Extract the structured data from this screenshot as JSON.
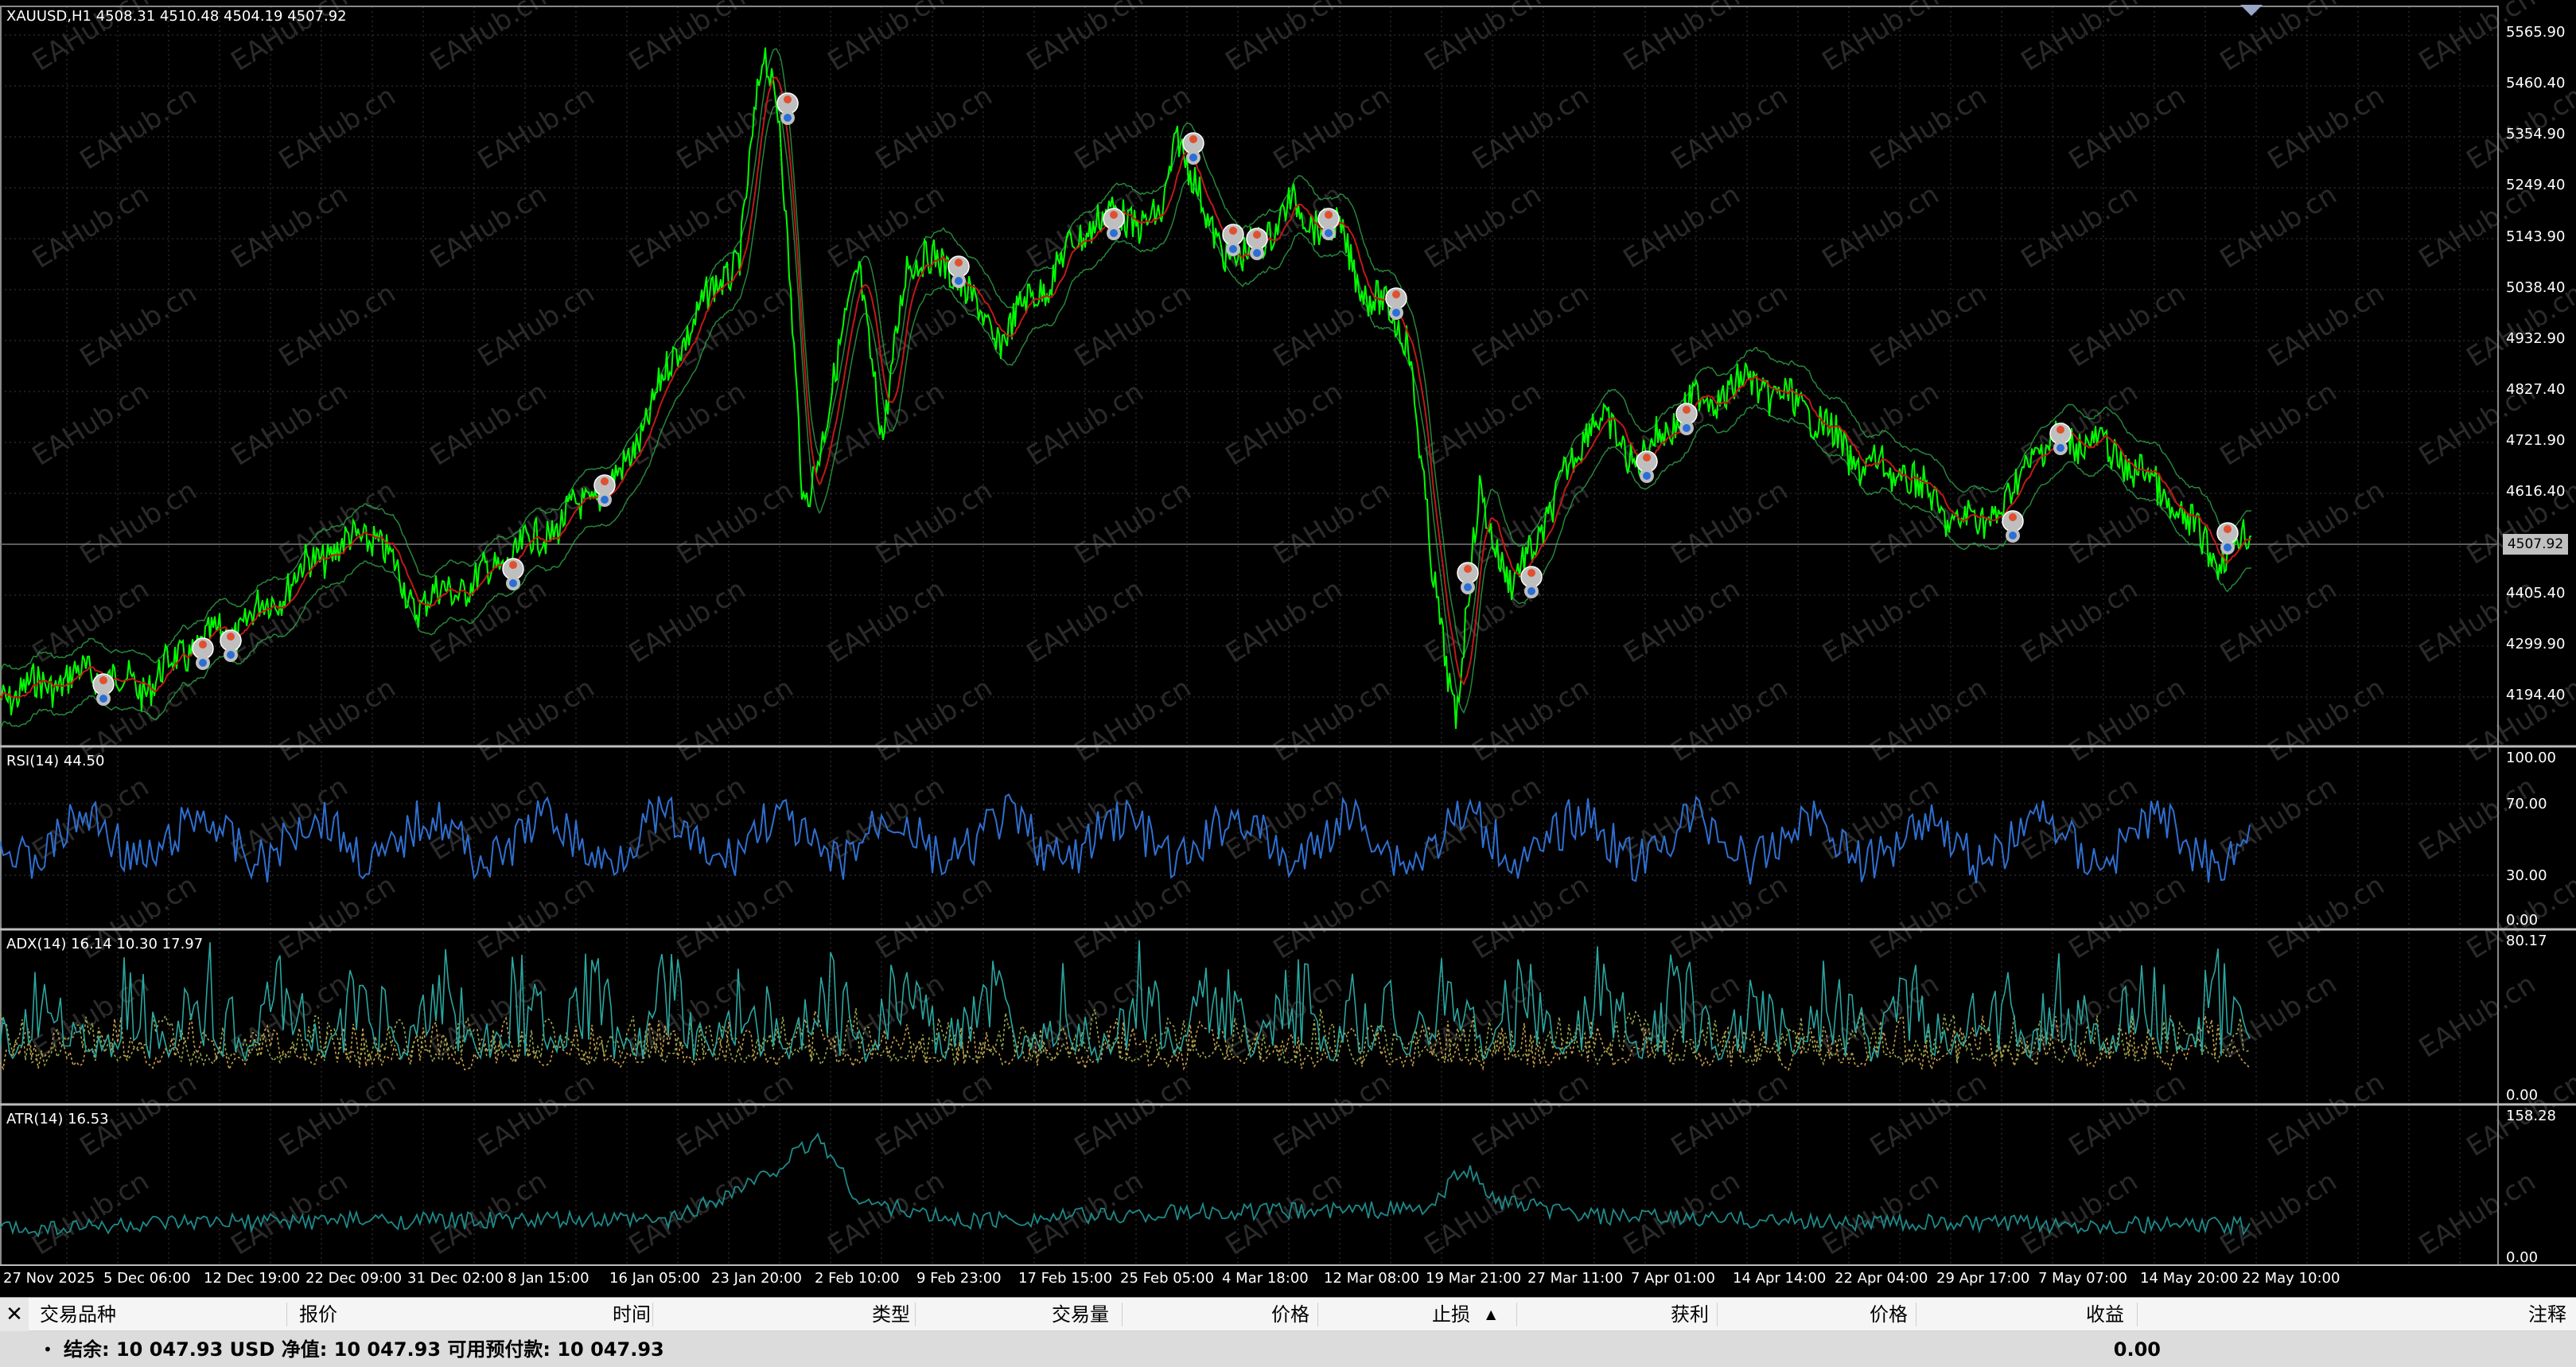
{
  "chart": {
    "title": "XAUUSD,H1  4508.31 4510.48 4504.19 4507.92",
    "current_price": "4507.92",
    "price_ticks": [
      "5565.90",
      "5460.40",
      "5354.90",
      "5249.40",
      "5143.90",
      "5038.40",
      "4932.90",
      "4827.40",
      "4721.90",
      "4616.40",
      "4405.40",
      "4299.90",
      "4194.40"
    ],
    "watermark": "EAHub.cn",
    "menu_arrow_icon": "triangle-down-icon"
  },
  "indicators": {
    "rsi": {
      "title": "RSI(14) 44.50",
      "ticks": [
        "100.00",
        "70.00",
        "30.00",
        "0.00"
      ]
    },
    "adx": {
      "title": "ADX(14) 16.14 10.30 17.97",
      "ticks": [
        "80.17",
        "0.00"
      ]
    },
    "atr": {
      "title": "ATR(14) 16.53",
      "ticks": [
        "158.28",
        "0.00"
      ]
    }
  },
  "time_axis": [
    "27 Nov 2025",
    "5 Dec 06:00",
    "12 Dec 19:00",
    "22 Dec 09:00",
    "31 Dec 02:00",
    "8 Jan 15:00",
    "16 Jan 05:00",
    "23 Jan 20:00",
    "2 Feb 10:00",
    "9 Feb 23:00",
    "17 Feb 15:00",
    "25 Feb 05:00",
    "4 Mar 18:00",
    "12 Mar 08:00",
    "19 Mar 21:00",
    "27 Mar 11:00",
    "7 Apr 01:00",
    "14 Apr 14:00",
    "22 Apr 04:00",
    "29 Apr 17:00",
    "7 May 07:00",
    "14 May 20:00",
    "22 May 10:00"
  ],
  "terminal": {
    "close_label": "✕",
    "columns": {
      "symbol": "交易品种",
      "quote": "报价",
      "time": "时间",
      "type": "类型",
      "volume": "交易量",
      "price": "价格",
      "sl": "止损",
      "tp": "获利",
      "price2": "价格",
      "profit": "收益",
      "comment": "注释"
    },
    "sort_icon": "sort-up-icon",
    "bullet": "•",
    "balance_line": "结余: 10 047.93 USD  净值: 10 047.93  可用预付款: 10 047.93",
    "profit_total": "0.00"
  },
  "colors": {
    "price_line": "#00ff00",
    "ma_line": "#c21818",
    "band_line": "#2ea84a",
    "rsi_line": "#2f6fd0",
    "adx_main": "#2aa6a0",
    "adx_plus": "#9aa84a",
    "adx_minus": "#c8a24a",
    "atr_line": "#1e8a8a",
    "grid": "#3a3a3a"
  }
}
